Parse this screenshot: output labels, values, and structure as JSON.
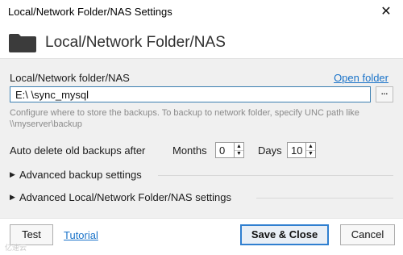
{
  "window": {
    "title": "Local/Network Folder/NAS Settings",
    "close_glyph": "✕"
  },
  "header": {
    "title": "Local/Network Folder/NAS",
    "icon": "folder-icon"
  },
  "folder": {
    "label": "Local/Network folder/NAS",
    "open_link": "Open folder",
    "path_value": "E:\\ \\sync_mysql",
    "browse_label": "...",
    "hint": "Configure where to store the backups. To backup to network folder, specify UNC path like \\\\myserver\\backup"
  },
  "auto_delete": {
    "label": "Auto delete old backups after",
    "months_label": "Months",
    "months_value": "0",
    "days_label": "Days",
    "days_value": "10"
  },
  "sections": [
    {
      "label": "Advanced backup settings"
    },
    {
      "label": "Advanced Local/Network Folder/NAS settings"
    }
  ],
  "footer": {
    "test_label": "Test",
    "tutorial_label": "Tutorial",
    "save_label": "Save & Close",
    "cancel_label": "Cancel",
    "watermark": "亿速云"
  },
  "colors": {
    "link": "#1a73c9",
    "accent_border": "#2f7fd0",
    "panel_bg": "#f0f0f0",
    "folder_icon": "#3b3b3b"
  }
}
